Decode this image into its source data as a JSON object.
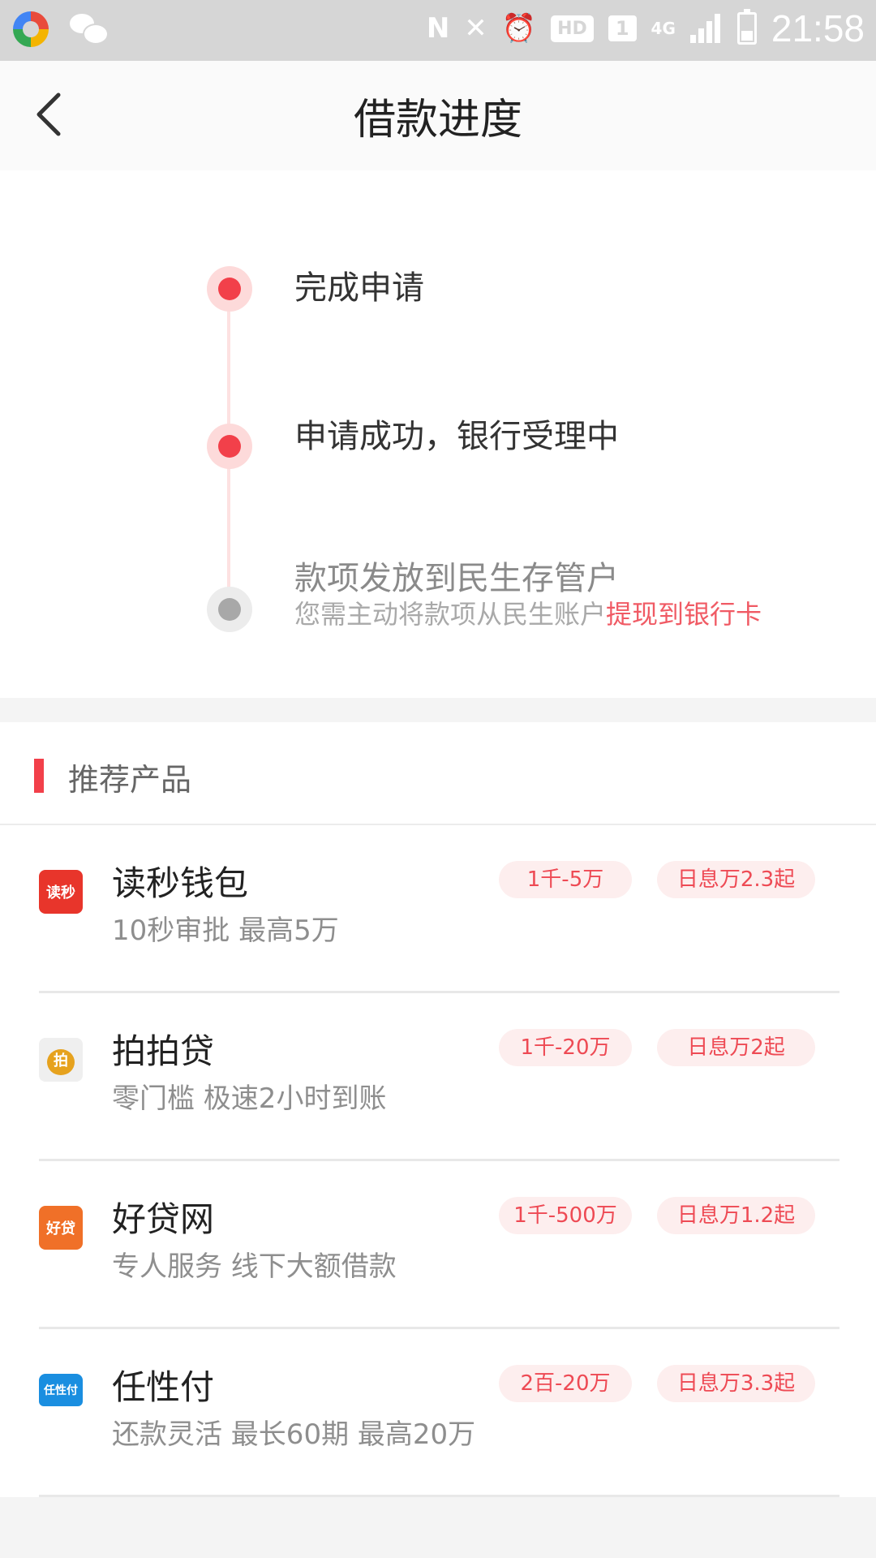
{
  "status_bar": {
    "time": "21:58",
    "hd_label": "HD",
    "sim_label": "1",
    "network_label": "4G"
  },
  "header": {
    "title": "借款进度"
  },
  "progress": {
    "steps": [
      {
        "title": "完成申请",
        "state": "done"
      },
      {
        "title": "申请成功，银行受理中",
        "state": "done"
      },
      {
        "title": "款项发放到民生存管户",
        "state": "pending",
        "subtitle": "您需主动将款项从民生账户",
        "subtitle_link": "提现到银行卡"
      }
    ]
  },
  "recommend": {
    "title": "推荐产品",
    "items": [
      {
        "name": "读秒钱包",
        "desc": "10秒审批 最高5万",
        "range": "1千-5万",
        "rate": "日息万2.3起",
        "logo_text": "读秒",
        "logo_color": "#e8352b"
      },
      {
        "name": "拍拍贷",
        "desc": "零门槛 极速2小时到账",
        "range": "1千-20万",
        "rate": "日息万2起",
        "logo_text": "拍",
        "logo_color": "#f0f0f0"
      },
      {
        "name": "好贷网",
        "desc": "专人服务 线下大额借款",
        "range": "1千-500万",
        "rate": "日息万1.2起",
        "logo_text": "好贷",
        "logo_color": "#f07028"
      },
      {
        "name": "任性付",
        "desc": "还款灵活 最长60期 最高20万",
        "range": "2百-20万",
        "rate": "日息万3.3起",
        "logo_text": "任性付",
        "logo_color": "#1a8ee0"
      }
    ]
  },
  "colors": {
    "accent": "#f2404a",
    "tag_bg": "#fdeeee",
    "status_bar": "#d6d6d6"
  }
}
